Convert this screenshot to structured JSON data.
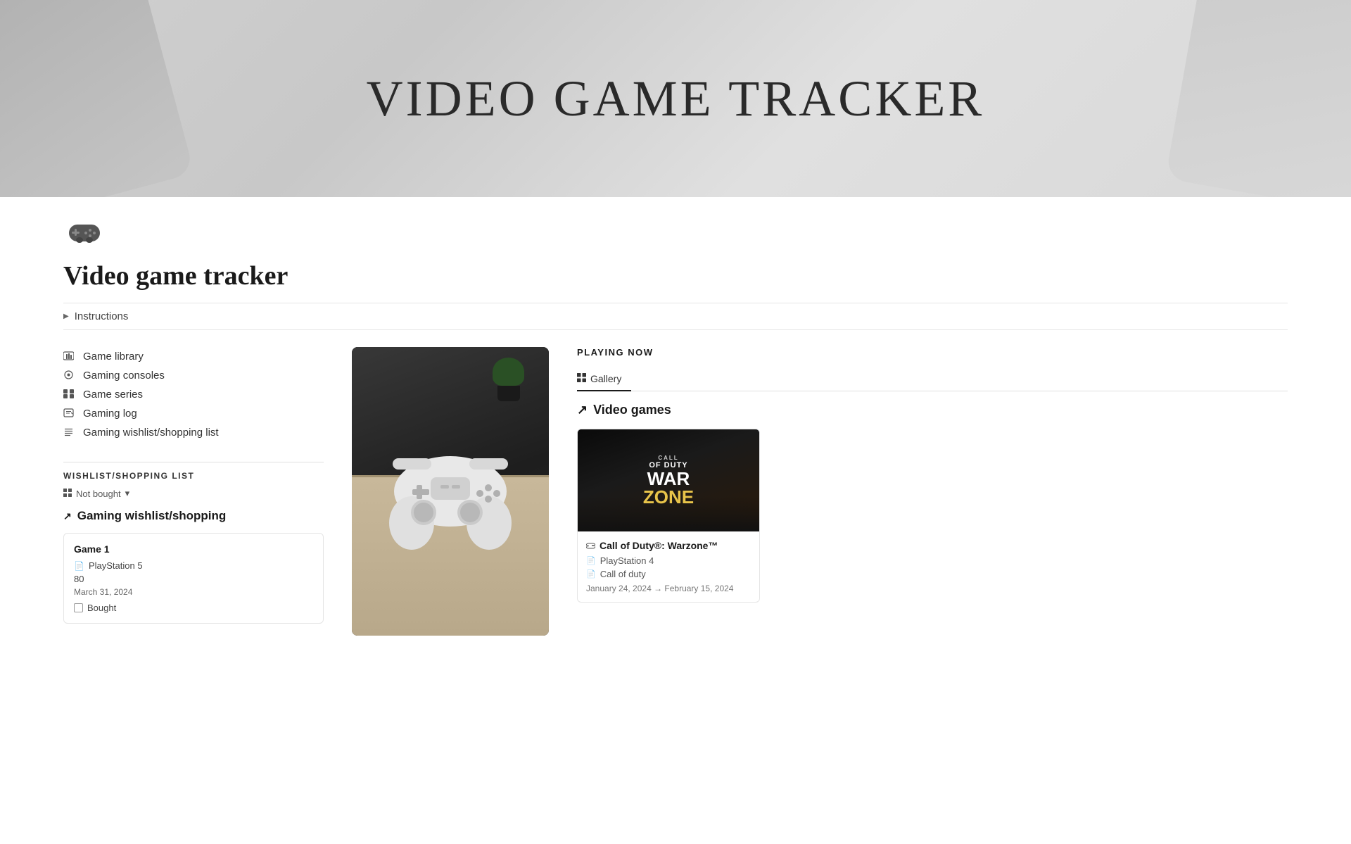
{
  "hero": {
    "title": "VIDEO GAME TRACKER"
  },
  "page": {
    "title": "Video game tracker",
    "icon": "🎮"
  },
  "instructions": {
    "label": "Instructions"
  },
  "nav": {
    "items": [
      {
        "id": "game-library",
        "label": "Game library",
        "icon": "🎮"
      },
      {
        "id": "gaming-consoles",
        "label": "Gaming consoles",
        "icon": "👤"
      },
      {
        "id": "game-series",
        "label": "Game series",
        "icon": "👾"
      },
      {
        "id": "gaming-log",
        "label": "Gaming log",
        "icon": "✏️"
      },
      {
        "id": "wishlist",
        "label": "Gaming wishlist/shopping list",
        "icon": "☰"
      }
    ]
  },
  "wishlist_section": {
    "title": "WISHLIST/SHOPPING LIST",
    "filter_label": "Not bought",
    "link_label": "Gaming wishlist/shopping",
    "game_card": {
      "title": "Game 1",
      "console": "PlayStation 5",
      "price": "80",
      "date": "March 31, 2024",
      "bought_label": "Bought"
    }
  },
  "playing_now": {
    "title": "PLAYING NOW",
    "tab_gallery": "Gallery",
    "db_link_label": "Video games",
    "arrow": "↗",
    "games": [
      {
        "title": "Call of Duty®: Warzone™",
        "console": "PlayStation 4",
        "series": "Call of duty",
        "dates": "January 24, 2024 → February 15, 2024"
      }
    ]
  }
}
